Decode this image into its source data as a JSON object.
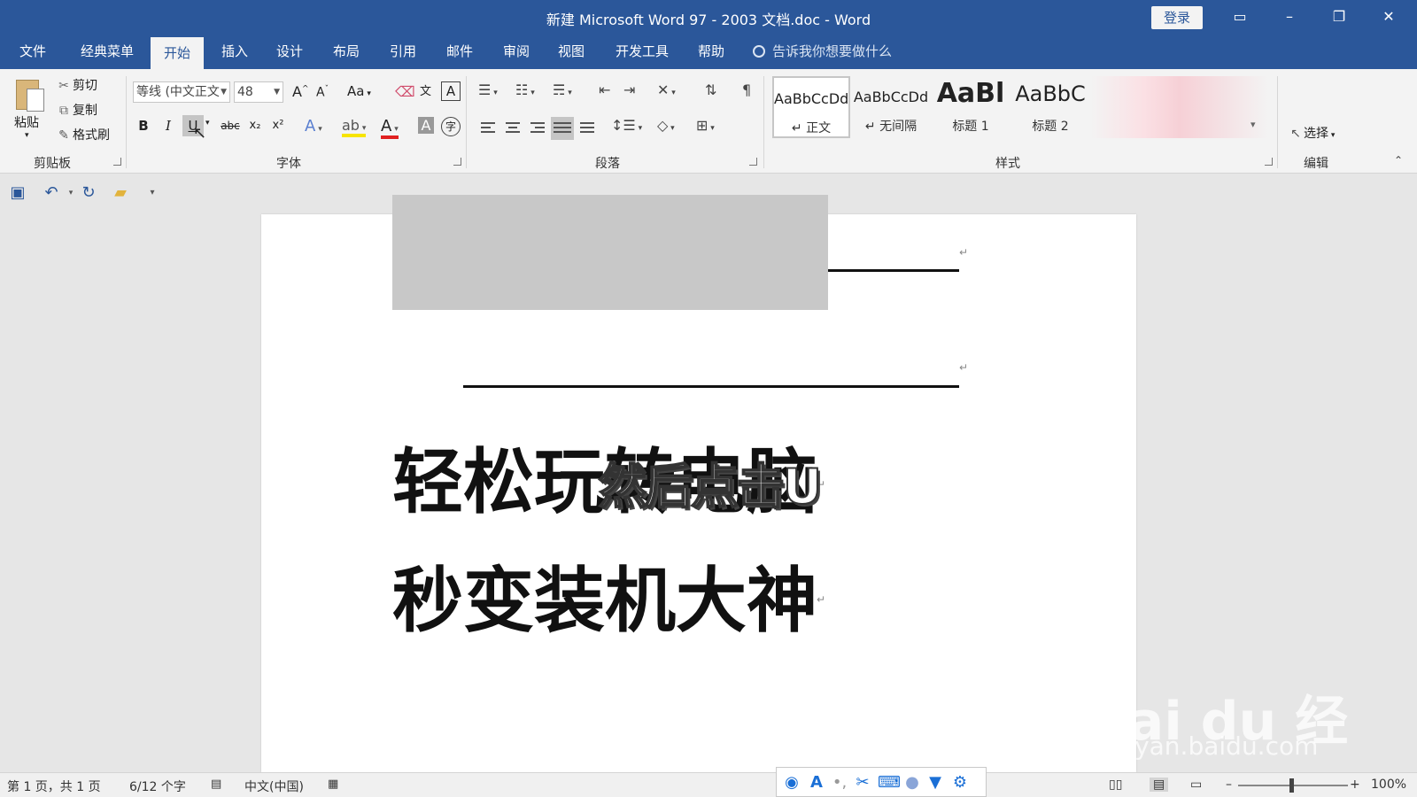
{
  "window": {
    "title": "新建 Microsoft Word 97 - 2003 文档.doc  -  Word",
    "login_label": "登录",
    "minimize": "–",
    "restore": "❐",
    "close": "✕",
    "ribbon_display": "▭"
  },
  "tabs": [
    {
      "label": "文件",
      "active": false
    },
    {
      "label": "经典菜单",
      "active": false
    },
    {
      "label": "开始",
      "active": true
    },
    {
      "label": "插入",
      "active": false
    },
    {
      "label": "设计",
      "active": false
    },
    {
      "label": "布局",
      "active": false
    },
    {
      "label": "引用",
      "active": false
    },
    {
      "label": "邮件",
      "active": false
    },
    {
      "label": "审阅",
      "active": false
    },
    {
      "label": "视图",
      "active": false
    },
    {
      "label": "开发工具",
      "active": false
    },
    {
      "label": "帮助",
      "active": false
    }
  ],
  "tell_me": "告诉我你想要做什么",
  "clipboard": {
    "paste": "粘贴",
    "cut": "剪切",
    "copy": "复制",
    "format_painter": "格式刷",
    "group_label": "剪贴板"
  },
  "font": {
    "font_name": "等线 (中文正文",
    "font_size": "48",
    "change_case": "Aa",
    "bold": "B",
    "italic": "I",
    "underline": "U",
    "strikethrough": "abc",
    "subscript": "x₂",
    "superscript": "x²",
    "group_label": "字体"
  },
  "paragraph": {
    "group_label": "段落"
  },
  "styles": {
    "group_label": "样式",
    "items": [
      {
        "sample": "AaBbCcDd",
        "name": "↵ 正文"
      },
      {
        "sample": "AaBbCcDd",
        "name": "↵ 无间隔"
      },
      {
        "sample": "AaBl",
        "name": "标题 1"
      },
      {
        "sample": "AaBbC",
        "name": "标题 2"
      }
    ]
  },
  "editing": {
    "select": "选择",
    "group_label": "编辑"
  },
  "document": {
    "line1": "轻松玩转电脑",
    "line2": "秒变装机大神",
    "paragraph_mark": "↵"
  },
  "caption": "然后点击U",
  "watermark": {
    "brand": "Bai du 经验",
    "url": "jingyan.baidu.com"
  },
  "statusbar": {
    "page": "第 1 页，共 1 页",
    "words": "6/12 个字",
    "language": "中文(中国)",
    "zoom": "100%",
    "zoom_minus": "–",
    "zoom_plus": "+"
  },
  "colors": {
    "brand_blue": "#2b579a",
    "ribbon_bg": "#f3f3f3",
    "selection_gray": "#c8c8c8"
  },
  "icons": [
    "save-icon",
    "undo-icon",
    "redo-icon",
    "open-folder-icon",
    "search-icon",
    "cursor-icon"
  ]
}
